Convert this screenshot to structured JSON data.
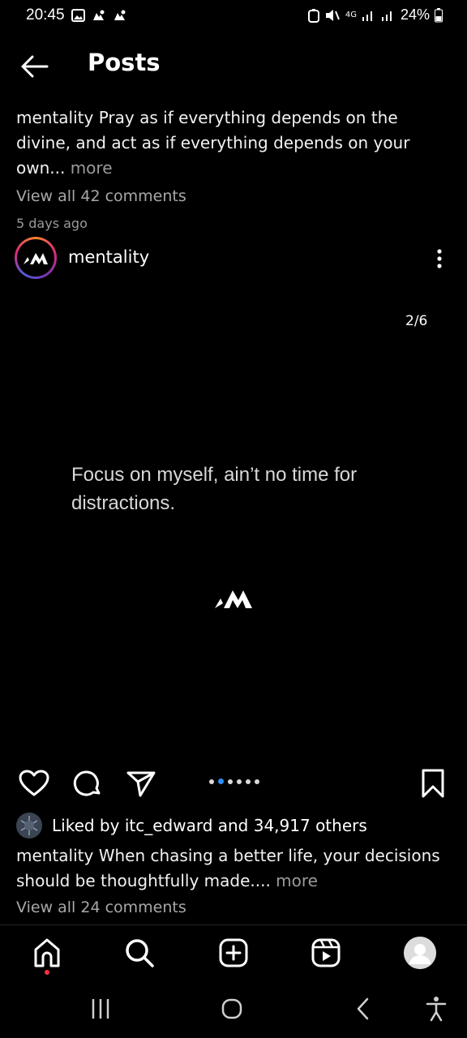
{
  "status_bar": {
    "time": "20:45",
    "network": "4G",
    "battery": "24%"
  },
  "header": {
    "title": "Posts",
    "back_icon": "arrow-left-icon"
  },
  "previous_post": {
    "username": "mentality",
    "caption": "Pray as if everything depends on the divine, and act as if everything depends on your own...",
    "more_label": "more",
    "view_comments": "View all 42 comments",
    "time_ago": "5 days ago"
  },
  "post": {
    "username": "mentality",
    "carousel_counter": "2/6",
    "quote": "Focus on myself, ain’t no time for distractions.",
    "carousel_total": 6,
    "carousel_index": 2,
    "liked_by": "Liked by itc_edward and 34,917 others",
    "caption_username": "mentality",
    "caption": "When chasing a better life, your decisions should be thoughtfully made....",
    "more_label": "more",
    "view_comments": "View all 24 comments"
  },
  "bottom_nav": {
    "items": [
      "home-icon",
      "search-icon",
      "create-icon",
      "reels-icon",
      "profile-avatar"
    ]
  },
  "system_nav": {
    "items": [
      "recents-icon",
      "home-circle-icon",
      "back-chevron-icon",
      "accessibility-icon"
    ]
  },
  "colors": {
    "background": "#000000",
    "accent_blue": "#2f8ff5",
    "notification_red": "#ff3040",
    "secondary_text": "#a8a8a8"
  }
}
